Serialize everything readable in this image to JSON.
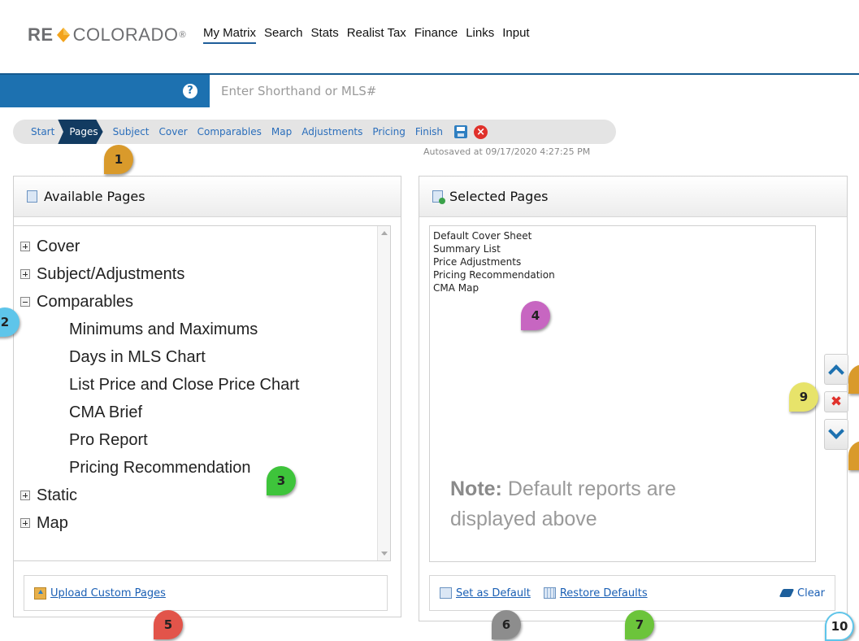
{
  "brand": {
    "prefix": "RE",
    "suffix": "COLORADO",
    "registered": "®"
  },
  "topnav": [
    "My Matrix",
    "Search",
    "Stats",
    "Realist Tax",
    "Finance",
    "Links",
    "Input"
  ],
  "search": {
    "help_glyph": "?",
    "placeholder": "Enter Shorthand or MLS#"
  },
  "breadcrumb": {
    "steps": [
      "Start",
      "Pages",
      "Subject",
      "Cover",
      "Comparables",
      "Map",
      "Adjustments",
      "Pricing",
      "Finish"
    ],
    "active": "Pages",
    "icons": [
      "save-icon",
      "close-icon"
    ],
    "autosave": "Autosaved at 09/17/2020 4:27:25 PM"
  },
  "available": {
    "title": "Available Pages",
    "tree": [
      {
        "label": "Cover",
        "expanded": false
      },
      {
        "label": "Subject/Adjustments",
        "expanded": false
      },
      {
        "label": "Comparables",
        "expanded": true
      },
      {
        "label": "Static",
        "expanded": false
      },
      {
        "label": "Map",
        "expanded": false
      }
    ],
    "comparables_children": [
      "Minimums and Maximums",
      "Days in MLS Chart",
      "List Price and Close Price Chart",
      "CMA Brief",
      "Pro Report",
      "Pricing Recommendation"
    ],
    "upload_label": "Upload Custom Pages"
  },
  "selected": {
    "title": "Selected Pages",
    "items": [
      "Default Cover Sheet",
      "Summary List",
      "Price Adjustments",
      "Pricing Recommendation",
      "CMA Map"
    ],
    "note_bold": "Note:",
    "note_text": " Default reports are displayed above",
    "remove_glyph": "✖",
    "set_default_label": "Set as Default",
    "restore_label": "Restore Defaults",
    "clear_label": "Clear"
  },
  "callouts": [
    "1",
    "2",
    "3",
    "4",
    "5",
    "6",
    "7",
    "9",
    "10"
  ],
  "colors": {
    "accent": "#1d71b0",
    "active_crumb": "#123b61",
    "link": "#1a5fb4",
    "remove": "#e0312b"
  }
}
